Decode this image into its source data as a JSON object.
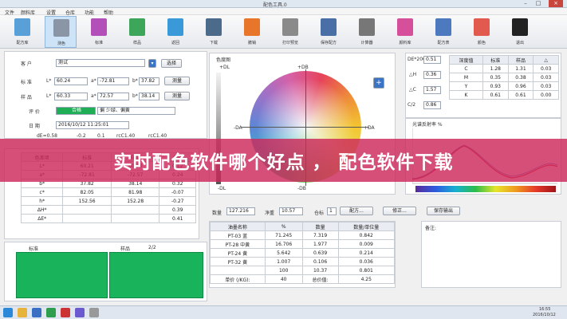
{
  "window": {
    "title": "配色工具.0"
  },
  "menu": [
    "文件",
    "颜料库",
    "设置",
    "仓库",
    "功能",
    "帮助"
  ],
  "toolbar": [
    {
      "label": "配方库",
      "color": "#5aa0d8"
    },
    {
      "label": "测色",
      "color": "#8a96a6"
    },
    {
      "label": "标准",
      "color": "#b34fb8"
    },
    {
      "label": "样品",
      "color": "#3ea65a"
    },
    {
      "label": "返回",
      "color": "#3a9ad9"
    },
    {
      "label": "下载",
      "color": "#4c6b8a"
    },
    {
      "label": "撤销",
      "color": "#e7752a"
    },
    {
      "label": "打印预览",
      "color": "#8a8a8a"
    },
    {
      "label": "保存配方",
      "color": "#4a6fa6"
    },
    {
      "label": "计算器",
      "color": "#777777"
    },
    {
      "label": "颜料库",
      "color": "#d64f9a"
    },
    {
      "label": "配方表",
      "color": "#4d7abf"
    },
    {
      "label": "颜色",
      "color": "#e25a4e"
    },
    {
      "label": "退出",
      "color": "#222222"
    }
  ],
  "customer": {
    "label": "客  户",
    "value": "测试",
    "button": "选择"
  },
  "standard": {
    "label": "标 准",
    "L": "60.24",
    "a": "-72.81",
    "b": "37.82",
    "button": "测量"
  },
  "sample": {
    "label": "样 品",
    "L": "60.33",
    "a": "72.57",
    "b": "38.14",
    "button": "测量"
  },
  "verdict": {
    "label": "评 价",
    "status": "合格",
    "note": "偏 少绿、偏黄"
  },
  "date": {
    "label": "日 期",
    "value": "2016/10/12 11:25:01"
  },
  "diff_row": [
    "dE=0.58",
    "-0.2",
    "0.1",
    "rcC1.40",
    "rcC1.40"
  ],
  "left_table": {
    "headers": [
      "色差项",
      "标准",
      "样品",
      "差值"
    ],
    "rows": [
      [
        "L*",
        "60.21",
        "60.33",
        "0.12"
      ],
      [
        "a*",
        "-72.81",
        "-72.57",
        "0.24"
      ],
      [
        "b*",
        "37.82",
        "38.14",
        "0.32"
      ],
      [
        "c*",
        "82.05",
        "81.98",
        "-0.07"
      ],
      [
        "h*",
        "152.56",
        "152.28",
        "-0.27"
      ],
      [
        "ΔH*",
        "",
        "",
        "0.39"
      ],
      [
        "ΔE*",
        "",
        "",
        "0.41"
      ]
    ]
  },
  "swatch": {
    "std_label": "标准",
    "smp_label": "样品",
    "count": "2/2"
  },
  "color_circle": {
    "title": "色度图",
    "top": "+DB",
    "bottom": "-DB",
    "left": "-DA",
    "right": "+DA",
    "l_top": "+DL",
    "l_bottom": "-DL"
  },
  "metrics": [
    {
      "label": "DE*2000",
      "value": "0.51"
    },
    {
      "label": "△H",
      "value": "0.36"
    },
    {
      "label": "△C",
      "value": "1.57"
    },
    {
      "label": "C/2",
      "value": "0.86"
    }
  ],
  "density_table": {
    "headers": [
      "深度值",
      "标准",
      "样品",
      "△"
    ],
    "rows": [
      [
        "C",
        "1.28",
        "1.31",
        "0.03"
      ],
      [
        "M",
        "0.35",
        "0.38",
        "0.03"
      ],
      [
        "Y",
        "0.93",
        "0.96",
        "0.03"
      ],
      [
        "K",
        "0.61",
        "0.61",
        "0.00"
      ]
    ]
  },
  "spectrum": {
    "title": "光谱反射率 %"
  },
  "formula": {
    "qty_label": "数量",
    "qty": "127.216",
    "net_label": "净重",
    "net": "10.57",
    "stock_label": "仓标",
    "stock": "1",
    "btn_recipe": "配方...",
    "btn_correct": "修正...",
    "btn_save": "保存输出",
    "headers": [
      "油墨名称",
      "%",
      "数量",
      "数量/单位量"
    ],
    "rows": [
      [
        "PT-03 蓝",
        "71.245",
        "7.319",
        "0.842"
      ],
      [
        "PT-28 中黄",
        "16.706",
        "1.977",
        "0.009"
      ],
      [
        "PT-24 黄",
        "5.642",
        "0.639",
        "0.214"
      ],
      [
        "PT-32 黄",
        "1.007",
        "0.106",
        "0.036"
      ],
      [
        "",
        "100",
        "10.37",
        "0.801"
      ]
    ],
    "footer": [
      "单价 (/KG):",
      "40",
      "总价值:",
      "4.25"
    ]
  },
  "notes_label": "备注:",
  "banner": "实时配色软件哪个好点 ， 配色软件下载",
  "clock": {
    "time": "16:55",
    "date": "2016/10/12"
  }
}
